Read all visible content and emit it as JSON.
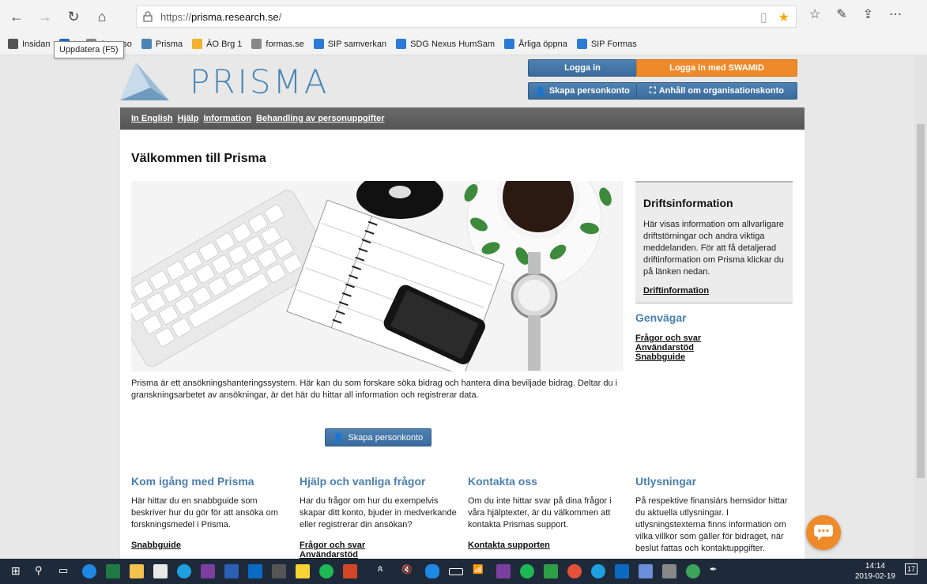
{
  "browser": {
    "url_prefix": "https://",
    "url_host": "prisma.research.se",
    "url_suffix": "/",
    "tooltip": "Uppdatera (F5)",
    "favorites": [
      {
        "label": "Insidan",
        "color": "#555"
      },
      {
        "label": "t",
        "color": "#1e6ad6"
      },
      {
        "label": "Agresso",
        "color": "#888"
      },
      {
        "label": "Prisma",
        "color": "#4a86b5"
      },
      {
        "label": "ÄO Brg 1",
        "color": "#f1b230"
      },
      {
        "label": "formas.se",
        "color": "#888"
      },
      {
        "label": "SIP samverkan",
        "color": "#2b7bd6"
      },
      {
        "label": "SDG Nexus HumSam",
        "color": "#2b7bd6"
      },
      {
        "label": "Årliga öppna",
        "color": "#2b7bd6"
      },
      {
        "label": "SIP Formas",
        "color": "#2b7bd6"
      }
    ]
  },
  "header": {
    "logo_text": "PRISMA",
    "login_label": "Logga in",
    "swamid_label": "Logga in med SWAMID",
    "create_account_label": "Skapa personkonto",
    "org_account_label": "Anhåll om organisationskonto"
  },
  "menu": [
    "In English",
    "Hjälp",
    "Information",
    "Behandling av personuppgifter"
  ],
  "main": {
    "title": "Välkommen till Prisma",
    "intro": "Prisma är ett ansökningshanteringssystem. Här kan du som forskare söka bidrag och hantera dina beviljade bidrag. Deltar du i granskningsarbetet av ansökningar, är det här du hittar all information och registrerar data.",
    "cta_label": "Skapa personkonto"
  },
  "drift": {
    "title": "Driftsinformation",
    "text": "Här visas information om allvarligare driftstörningar och andra viktiga meddelanden. För att få detaljerad driftinformation om Prisma klickar du på länken nedan.",
    "link": "Driftinformation"
  },
  "shortcuts": {
    "title": "Genvägar",
    "links": [
      "Frågor och svar",
      "Användarstöd",
      "Snabbguide"
    ]
  },
  "columns": [
    {
      "title": "Kom igång med Prisma",
      "text": "Här hittar du en snabbguide som beskriver hur du gör för att ansöka om forskningsmedel i Prisma.",
      "links": [
        "Snabbguide"
      ]
    },
    {
      "title": "Hjälp och vanliga frågor",
      "text": "Har du frågor om hur du exempelvis skapar ditt konto, bjuder in medverkande eller registrerar din ansökan?",
      "links": [
        "Frågor och svar",
        "Användarstöd"
      ]
    },
    {
      "title": "Kontakta oss",
      "text": "Om du inte hittar svar på dina frågor i våra hjälptexter, är du välkommen att kontakta Prismas support.",
      "links": [
        "Kontakta supporten"
      ]
    },
    {
      "title": "Utlysningar",
      "text": "På respektive finansiärs hemsidor hittar du aktuella utlysningar. I utlysningstexterna finns information om vilka villkor som gäller för bidraget, när beslut fattas och kontaktuppgifter.",
      "links": []
    }
  ],
  "taskbar": {
    "time": "14:14",
    "date": "2019-02-19",
    "notifications": "17"
  }
}
